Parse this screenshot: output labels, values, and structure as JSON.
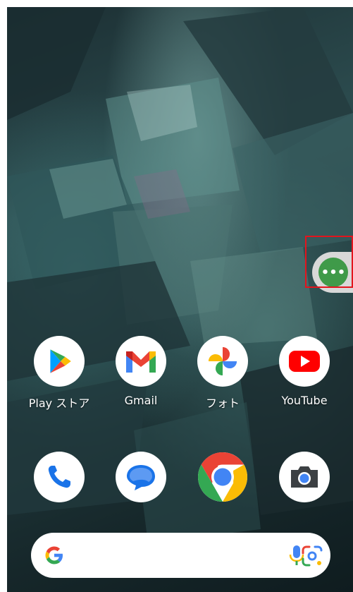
{
  "wallpaper": {
    "theme": "dark teal crystal"
  },
  "side_handle": {
    "icon": "more-horizontal-icon",
    "color": "#3f9a49",
    "glyph": "•••"
  },
  "apps_row1": [
    {
      "label": "Play ストア",
      "icon": "play-store-icon"
    },
    {
      "label": "Gmail",
      "icon": "gmail-icon"
    },
    {
      "label": "フォト",
      "icon": "photos-icon"
    },
    {
      "label": "YouTube",
      "icon": "youtube-icon"
    }
  ],
  "dock": [
    {
      "icon": "phone-icon"
    },
    {
      "icon": "messages-icon"
    },
    {
      "icon": "chrome-icon"
    },
    {
      "icon": "camera-icon"
    }
  ],
  "search_bar": {
    "logo": "google-g-icon",
    "mic": "microphone-icon",
    "lens": "google-lens-icon"
  },
  "colors": {
    "handle_border": "#e3141d",
    "google_blue": "#4285f4",
    "google_red": "#ea4335",
    "google_yellow": "#fbbc05",
    "google_green": "#34a853"
  }
}
